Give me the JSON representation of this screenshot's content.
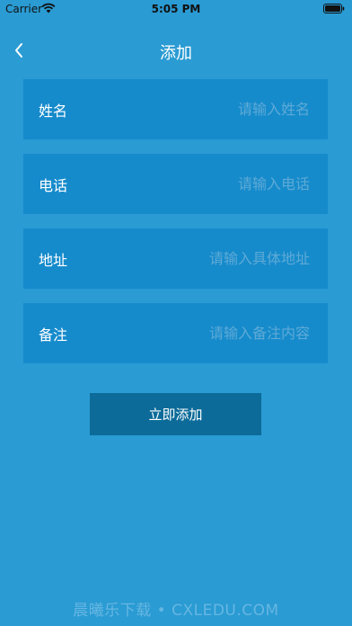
{
  "status_bar": {
    "carrier": "Carrier",
    "time": "5:05 PM",
    "wifi_icon": "wifi-icon",
    "battery_icon": "battery-icon"
  },
  "nav": {
    "title": "添加",
    "back_icon": "chevron-left-icon"
  },
  "form": {
    "fields": [
      {
        "label": "姓名",
        "placeholder": "请输入姓名",
        "value": ""
      },
      {
        "label": "电话",
        "placeholder": "请输入电话",
        "value": ""
      },
      {
        "label": "地址",
        "placeholder": "请输入具体地址",
        "value": ""
      },
      {
        "label": "备注",
        "placeholder": "请输入备注内容",
        "value": ""
      }
    ],
    "submit_label": "立即添加"
  },
  "watermark": "晨曦乐下载 • CXLEDU.COM",
  "colors": {
    "background": "#2a9bd3",
    "field_background": "#168bcc",
    "button_background": "#0c6b99",
    "placeholder": "#5eaad6"
  }
}
